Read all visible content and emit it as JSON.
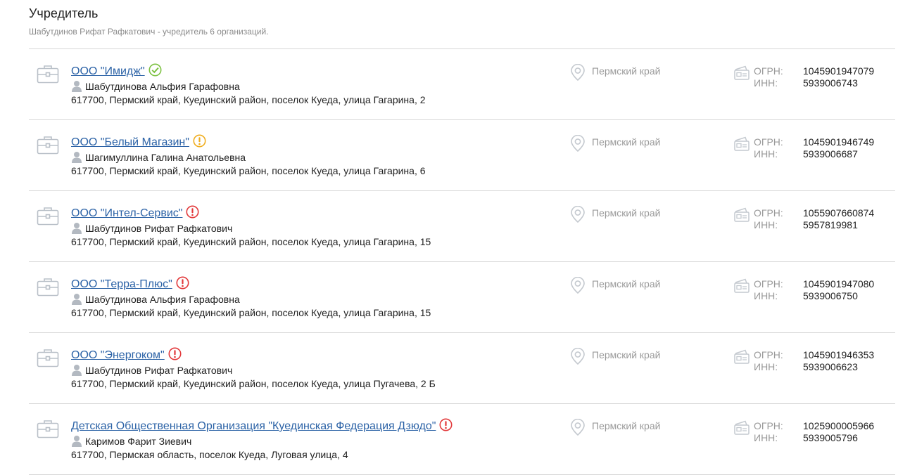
{
  "section": {
    "title": "Учредитель",
    "subtitle": "Шабутдинов Рифат Рафкатович - учредитель 6 организаций."
  },
  "labels": {
    "ogrn": "ОГРН:",
    "inn": "ИНН:"
  },
  "colors": {
    "link": "#2b62a6",
    "ok": "#7cc141",
    "warn": "#f0ad1e",
    "danger": "#e2383a",
    "muted": "#9a9a9a"
  },
  "orgs": [
    {
      "name": "ООО \"Имидж\"",
      "status": "ok",
      "person": "Шабутдинова Альфия Гарафовна",
      "address": "617700, Пермский край, Куединский район, поселок Куеда, улица Гагарина, 2",
      "region": "Пермский край",
      "ogrn": "1045901947079",
      "inn": "5939006743"
    },
    {
      "name": "ООО \"Белый Магазин\"",
      "status": "warning",
      "person": "Шагимуллина Галина Анатольевна",
      "address": "617700, Пермский край, Куединский район, поселок Куеда, улица Гагарина, 6",
      "region": "Пермский край",
      "ogrn": "1045901946749",
      "inn": "5939006687"
    },
    {
      "name": "ООО \"Интел-Сервис\"",
      "status": "danger",
      "person": "Шабутдинов Рифат Рафкатович",
      "address": "617700, Пермский край, Куединский район, поселок Куеда, улица Гагарина, 15",
      "region": "Пермский край",
      "ogrn": "1055907660874",
      "inn": "5957819981"
    },
    {
      "name": "ООО \"Терра-Плюс\"",
      "status": "danger",
      "person": "Шабутдинова Альфия Гарафовна",
      "address": "617700, Пермский край, Куединский район, поселок Куеда, улица Гагарина, 15",
      "region": "Пермский край",
      "ogrn": "1045901947080",
      "inn": "5939006750"
    },
    {
      "name": "ООО \"Энергоком\"",
      "status": "danger",
      "person": "Шабутдинов Рифат Рафкатович",
      "address": "617700, Пермский край, Куединский район, поселок Куеда, улица Пугачева, 2 Б",
      "region": "Пермский край",
      "ogrn": "1045901946353",
      "inn": "5939006623"
    },
    {
      "name": "Детская Общественная Организация \"Куединская Федерация Дзюдо\"",
      "status": "danger",
      "person": "Каримов Фарит Зиевич",
      "address": "617700, Пермская область, поселок Куеда, Луговая улица, 4",
      "region": "Пермский край",
      "ogrn": "1025900005966",
      "inn": "5939005796"
    }
  ]
}
